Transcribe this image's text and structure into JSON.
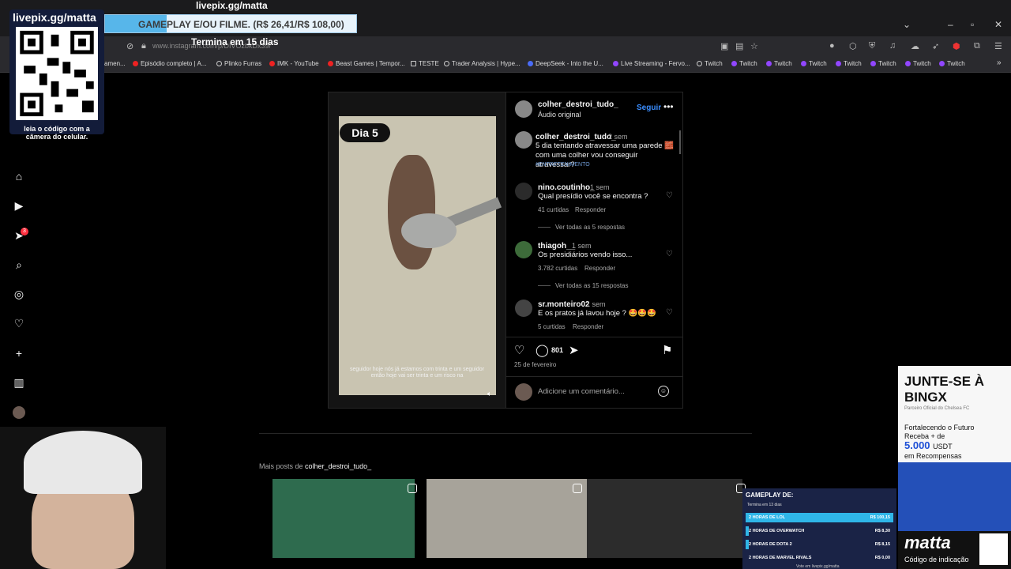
{
  "stream": {
    "title": "livepix.gg/matta",
    "alert": "GAMEPLAY E/OU FILME. (R$ 26,41/R$ 108,00)",
    "alert_progress": 0.2445,
    "alert_sub": "Termina em 15 dias",
    "qr_title": "livepix.gg/matta",
    "qr_caption": "leia o código com a câmera do celular."
  },
  "browser": {
    "url": "www.instagram.com/p/DIVOzbkDx39/",
    "bookmarks": [
      "amen...",
      "Episódio completo | A...",
      "Plinko Furras",
      "IMK - YouTube",
      "Beast Games | Tempor...",
      "TESTE",
      "Trader Analysis | Hype...",
      "DeepSeek - Into the U...",
      "Live Streaming - Fervo...",
      "Twitch",
      "Twitch",
      "Twitch",
      "Twitch",
      "Twitch",
      "Twitch",
      "Twitch",
      "Twitch"
    ]
  },
  "sidebar": {
    "notif_count": "3"
  },
  "post": {
    "author": "colher_destroi_tudo_",
    "audio": "Áudio original",
    "follow": "Seguir",
    "day_label": "Dia 5",
    "video_caption": "seguidor hoje nós já estamos com trinta e um seguidor então hoje vai ser trinta e um risco na",
    "caption_user": "colher_destroi_tudo_",
    "caption_age": "2 sem",
    "caption_text": "5 dia tentando atravessar uma parede 🧱 com uma colher vou conseguir atravessar?",
    "hashtag": "#ENTRETENIMENTO",
    "comments": [
      {
        "user": "nino.coutinho_",
        "age": "1 sem",
        "text": "Qual presídio você se encontra ?",
        "likes": "41 curtidas",
        "reply": "Responder",
        "view_replies": "Ver todas as 5 respostas"
      },
      {
        "user": "thiagoh__",
        "age": "1 sem",
        "text": "Os presidiários vendo isso...",
        "likes": "3.782 curtidas",
        "reply": "Responder",
        "view_replies": "Ver todas as 15 respostas"
      },
      {
        "user": "sr.monteiro02",
        "age": "1 sem",
        "text": "E os pratos já lavou hoje ? 🤩🤩🤩",
        "likes": "5 curtidas",
        "reply": "Responder",
        "view_replies": ""
      }
    ],
    "comment_count": "801",
    "date": "25 de fevereiro",
    "comment_placeholder": "Adicione um comentário..."
  },
  "more_posts": {
    "prefix": "Mais posts de",
    "user": "colher_destroi_tudo_"
  },
  "gameplay": {
    "title": "GAMEPLAY DE:",
    "sub": "Termina em 13 dias",
    "rows": [
      {
        "label": "2 HORAS DE LOL",
        "value": "R$ 100,15",
        "progress": 1.0
      },
      {
        "label": "2 HORAS DE OVERWATCH",
        "value": "R$ 8,30",
        "progress": 0.02
      },
      {
        "label": "2 HORAS DE DOTA 2",
        "value": "R$ 8,15",
        "progress": 0.02
      },
      {
        "label": "2 HORAS DE MARVEL RIVALS",
        "value": "R$ 0,00",
        "progress": 0.0
      }
    ],
    "foot": "Vote em livepix.gg/matta"
  },
  "bingx": {
    "title": "JUNTE-SE À BINGX",
    "sub": "Parceiro Oficial do Chelsea FC",
    "line1": "Fortalecendo o Futuro",
    "line2": "Receba + de",
    "amount": "5.000",
    "unit": "USDT",
    "line3": "em Recompensas"
  },
  "matta": {
    "logo": "matta",
    "sub": "Código de indicação"
  }
}
